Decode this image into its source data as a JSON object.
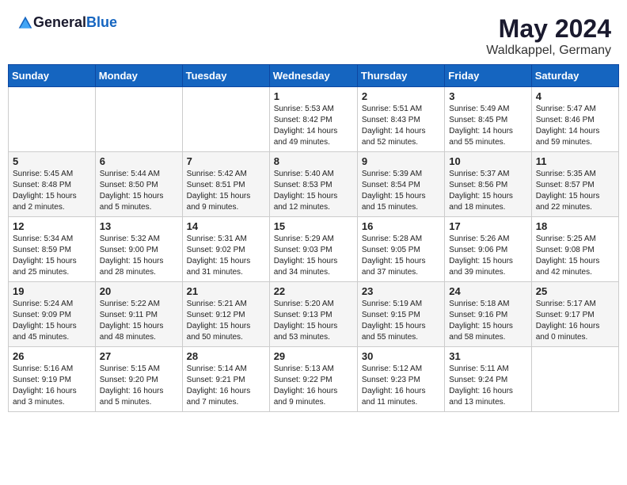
{
  "header": {
    "logo_general": "General",
    "logo_blue": "Blue",
    "month_year": "May 2024",
    "location": "Waldkappel, Germany"
  },
  "weekdays": [
    "Sunday",
    "Monday",
    "Tuesday",
    "Wednesday",
    "Thursday",
    "Friday",
    "Saturday"
  ],
  "weeks": [
    [
      {
        "day": "",
        "info": ""
      },
      {
        "day": "",
        "info": ""
      },
      {
        "day": "",
        "info": ""
      },
      {
        "day": "1",
        "info": "Sunrise: 5:53 AM\nSunset: 8:42 PM\nDaylight: 14 hours\nand 49 minutes."
      },
      {
        "day": "2",
        "info": "Sunrise: 5:51 AM\nSunset: 8:43 PM\nDaylight: 14 hours\nand 52 minutes."
      },
      {
        "day": "3",
        "info": "Sunrise: 5:49 AM\nSunset: 8:45 PM\nDaylight: 14 hours\nand 55 minutes."
      },
      {
        "day": "4",
        "info": "Sunrise: 5:47 AM\nSunset: 8:46 PM\nDaylight: 14 hours\nand 59 minutes."
      }
    ],
    [
      {
        "day": "5",
        "info": "Sunrise: 5:45 AM\nSunset: 8:48 PM\nDaylight: 15 hours\nand 2 minutes."
      },
      {
        "day": "6",
        "info": "Sunrise: 5:44 AM\nSunset: 8:50 PM\nDaylight: 15 hours\nand 5 minutes."
      },
      {
        "day": "7",
        "info": "Sunrise: 5:42 AM\nSunset: 8:51 PM\nDaylight: 15 hours\nand 9 minutes."
      },
      {
        "day": "8",
        "info": "Sunrise: 5:40 AM\nSunset: 8:53 PM\nDaylight: 15 hours\nand 12 minutes."
      },
      {
        "day": "9",
        "info": "Sunrise: 5:39 AM\nSunset: 8:54 PM\nDaylight: 15 hours\nand 15 minutes."
      },
      {
        "day": "10",
        "info": "Sunrise: 5:37 AM\nSunset: 8:56 PM\nDaylight: 15 hours\nand 18 minutes."
      },
      {
        "day": "11",
        "info": "Sunrise: 5:35 AM\nSunset: 8:57 PM\nDaylight: 15 hours\nand 22 minutes."
      }
    ],
    [
      {
        "day": "12",
        "info": "Sunrise: 5:34 AM\nSunset: 8:59 PM\nDaylight: 15 hours\nand 25 minutes."
      },
      {
        "day": "13",
        "info": "Sunrise: 5:32 AM\nSunset: 9:00 PM\nDaylight: 15 hours\nand 28 minutes."
      },
      {
        "day": "14",
        "info": "Sunrise: 5:31 AM\nSunset: 9:02 PM\nDaylight: 15 hours\nand 31 minutes."
      },
      {
        "day": "15",
        "info": "Sunrise: 5:29 AM\nSunset: 9:03 PM\nDaylight: 15 hours\nand 34 minutes."
      },
      {
        "day": "16",
        "info": "Sunrise: 5:28 AM\nSunset: 9:05 PM\nDaylight: 15 hours\nand 37 minutes."
      },
      {
        "day": "17",
        "info": "Sunrise: 5:26 AM\nSunset: 9:06 PM\nDaylight: 15 hours\nand 39 minutes."
      },
      {
        "day": "18",
        "info": "Sunrise: 5:25 AM\nSunset: 9:08 PM\nDaylight: 15 hours\nand 42 minutes."
      }
    ],
    [
      {
        "day": "19",
        "info": "Sunrise: 5:24 AM\nSunset: 9:09 PM\nDaylight: 15 hours\nand 45 minutes."
      },
      {
        "day": "20",
        "info": "Sunrise: 5:22 AM\nSunset: 9:11 PM\nDaylight: 15 hours\nand 48 minutes."
      },
      {
        "day": "21",
        "info": "Sunrise: 5:21 AM\nSunset: 9:12 PM\nDaylight: 15 hours\nand 50 minutes."
      },
      {
        "day": "22",
        "info": "Sunrise: 5:20 AM\nSunset: 9:13 PM\nDaylight: 15 hours\nand 53 minutes."
      },
      {
        "day": "23",
        "info": "Sunrise: 5:19 AM\nSunset: 9:15 PM\nDaylight: 15 hours\nand 55 minutes."
      },
      {
        "day": "24",
        "info": "Sunrise: 5:18 AM\nSunset: 9:16 PM\nDaylight: 15 hours\nand 58 minutes."
      },
      {
        "day": "25",
        "info": "Sunrise: 5:17 AM\nSunset: 9:17 PM\nDaylight: 16 hours\nand 0 minutes."
      }
    ],
    [
      {
        "day": "26",
        "info": "Sunrise: 5:16 AM\nSunset: 9:19 PM\nDaylight: 16 hours\nand 3 minutes."
      },
      {
        "day": "27",
        "info": "Sunrise: 5:15 AM\nSunset: 9:20 PM\nDaylight: 16 hours\nand 5 minutes."
      },
      {
        "day": "28",
        "info": "Sunrise: 5:14 AM\nSunset: 9:21 PM\nDaylight: 16 hours\nand 7 minutes."
      },
      {
        "day": "29",
        "info": "Sunrise: 5:13 AM\nSunset: 9:22 PM\nDaylight: 16 hours\nand 9 minutes."
      },
      {
        "day": "30",
        "info": "Sunrise: 5:12 AM\nSunset: 9:23 PM\nDaylight: 16 hours\nand 11 minutes."
      },
      {
        "day": "31",
        "info": "Sunrise: 5:11 AM\nSunset: 9:24 PM\nDaylight: 16 hours\nand 13 minutes."
      },
      {
        "day": "",
        "info": ""
      }
    ]
  ]
}
